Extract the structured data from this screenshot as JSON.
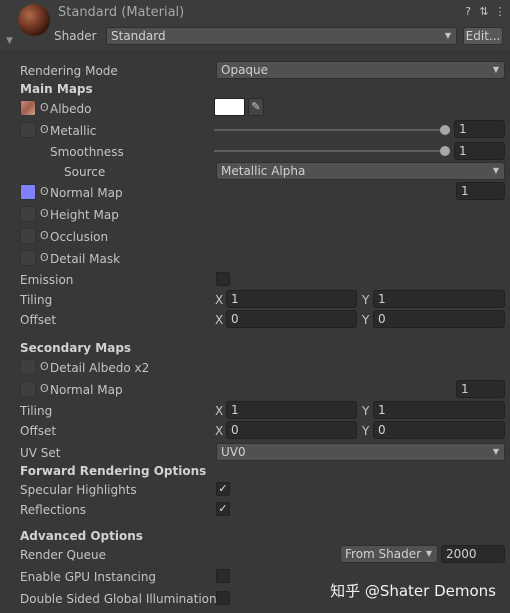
{
  "header": {
    "title": "Standard (Material)",
    "shader_label": "Shader",
    "shader_value": "Standard",
    "edit_label": "Edit...",
    "icons": [
      "help-icon",
      "settings-sliders-icon",
      "more-icon"
    ]
  },
  "rendering_mode": {
    "label": "Rendering Mode",
    "value": "Opaque"
  },
  "main_maps": {
    "heading": "Main Maps",
    "albedo": {
      "label": "Albedo",
      "color": "#ffffff"
    },
    "metallic": {
      "label": "Metallic",
      "value": "1"
    },
    "smoothness": {
      "label": "Smoothness",
      "value": "1"
    },
    "source": {
      "label": "Source",
      "value": "Metallic Alpha"
    },
    "normal_map": {
      "label": "Normal Map",
      "value": "1"
    },
    "height_map": {
      "label": "Height Map"
    },
    "occlusion": {
      "label": "Occlusion"
    },
    "detail_mask": {
      "label": "Detail Mask"
    },
    "emission": {
      "label": "Emission"
    },
    "tiling": {
      "label": "Tiling",
      "x": "1",
      "y": "1"
    },
    "offset": {
      "label": "Offset",
      "x": "0",
      "y": "0"
    }
  },
  "secondary_maps": {
    "heading": "Secondary Maps",
    "detail_albedo": {
      "label": "Detail Albedo x2"
    },
    "normal_map": {
      "label": "Normal Map",
      "value": "1"
    },
    "tiling": {
      "label": "Tiling",
      "x": "1",
      "y": "1"
    },
    "offset": {
      "label": "Offset",
      "x": "0",
      "y": "0"
    },
    "uv_set": {
      "label": "UV Set",
      "value": "UV0"
    }
  },
  "forward": {
    "heading": "Forward Rendering Options",
    "specular": {
      "label": "Specular Highlights",
      "checked": "✓"
    },
    "reflections": {
      "label": "Reflections",
      "checked": "✓"
    }
  },
  "advanced": {
    "heading": "Advanced Options",
    "render_queue": {
      "label": "Render Queue",
      "mode": "From Shader",
      "value": "2000"
    },
    "gpu_instancing": {
      "label": "Enable GPU Instancing"
    },
    "double_sided_gi": {
      "label": "Double Sided Global Illumination"
    }
  },
  "axis": {
    "x": "X",
    "y": "Y"
  },
  "glyphs": {
    "dot": "ʘ",
    "down_arrow": "▼",
    "fold": "▼",
    "eyedropper": "✎"
  },
  "watermark": "知乎 @Shater Demons",
  "colors": {
    "background": "#383838",
    "normal_swatch": "#8080ff"
  }
}
